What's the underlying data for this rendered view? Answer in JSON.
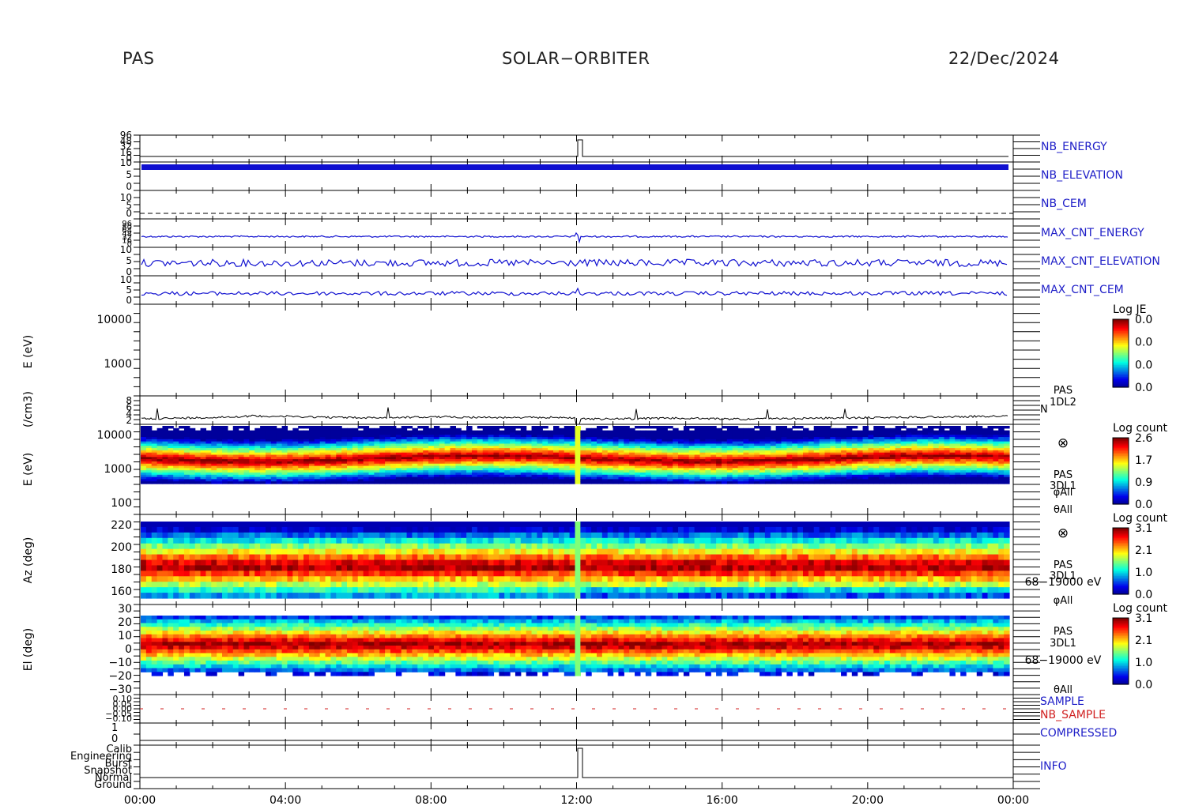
{
  "header": {
    "instrument": "PAS",
    "mission": "SOLAR−ORBITER",
    "date": "22/Dec/2024"
  },
  "time_axis": {
    "ticks": [
      "00:00",
      "04:00",
      "08:00",
      "12:00",
      "16:00",
      "20:00",
      "00:00"
    ]
  },
  "colors": {
    "trace_blue": "#1010d0",
    "label_blue": "#2020c8",
    "label_red": "#d02020",
    "axis": "#000000"
  },
  "panels": {
    "nb_energy": {
      "label": "NB_ENERGY",
      "yticks": [
        "96",
        "48",
        "32",
        "16",
        "0"
      ]
    },
    "nb_elevation": {
      "label": "NB_ELEVATION",
      "yticks": [
        "10",
        "5",
        "0"
      ]
    },
    "nb_cem": {
      "label": "NB_CEM",
      "yticks": [
        "10",
        "5",
        "0"
      ]
    },
    "max_cnt_energy": {
      "label": "MAX_CNT_ENERGY",
      "yticks": [
        "96",
        "80",
        "64",
        "48",
        "32",
        "16",
        "0"
      ]
    },
    "max_cnt_elevation": {
      "label": "MAX_CNT_ELEVATION",
      "yticks": [
        "10",
        "5",
        "0"
      ]
    },
    "max_cnt_cem": {
      "label": "MAX_CNT_CEM",
      "yticks": [
        "10",
        "5",
        "0"
      ]
    },
    "e_l2": {
      "ylabel": "E (eV)",
      "yticks": [
        "10000",
        "1000"
      ],
      "cbar_title": "Log JE",
      "cbar_ticks": [
        "0.0",
        "0.0",
        "0.0",
        "0.0"
      ]
    },
    "density": {
      "ylabel": "(/cm3)",
      "yticks": [
        "8",
        "6",
        "4",
        "2"
      ],
      "side_label_1": "PAS",
      "side_label_2": "1DL2",
      "side_label_3": "N"
    },
    "e_l1": {
      "ylabel": "E (eV)",
      "yticks": [
        "10000",
        "1000",
        "100"
      ],
      "cbar_title": "Log count",
      "cbar_ticks": [
        "2.6",
        "1.7",
        "0.9",
        "0.0"
      ],
      "sym": "⊗",
      "side_label_1": "PAS",
      "side_label_2": "3DL1",
      "side_label_3": "φAll",
      "side_label_4": "θAll"
    },
    "az": {
      "ylabel": "Az (deg)",
      "yticks": [
        "220",
        "200",
        "180",
        "160"
      ],
      "cbar_title": "Log count",
      "cbar_ticks": [
        "3.1",
        "2.1",
        "1.0",
        "0.0"
      ],
      "sym": "⊗",
      "side_label_1": "PAS",
      "side_label_2": "3DL1",
      "side_label_3": "68−19000 eV",
      "side_label_4": "φAll"
    },
    "el": {
      "ylabel": "El (deg)",
      "yticks": [
        "30",
        "20",
        "10",
        "0",
        "−10",
        "−20",
        "−30"
      ],
      "cbar_title": "Log count",
      "cbar_ticks": [
        "3.1",
        "2.1",
        "1.0",
        "0.0"
      ],
      "side_label_1": "PAS",
      "side_label_2": "3DL1",
      "side_label_3": "68−19000 eV",
      "side_label_4": "θAll"
    },
    "sample": {
      "label_1": "SAMPLE",
      "label_2": "NB_SAMPLE",
      "yticks": [
        "0.10",
        "0.05",
        "0.00",
        "−0.05",
        "−0.10"
      ]
    },
    "compressed": {
      "label": "COMPRESSED",
      "yticks": [
        "1",
        "0"
      ]
    },
    "info": {
      "label": "INFO",
      "yticks": [
        "Calib",
        "Engineering",
        "Burst",
        "Snapshot",
        "Normal",
        "Ground"
      ]
    }
  },
  "chart_data": {
    "type": "heatmap",
    "x_range": [
      "00:00",
      "24:00"
    ],
    "series": [
      {
        "name": "N",
        "values_cm3": [
          3.3,
          3.4,
          3.6,
          3.9,
          3.8,
          3.6,
          3.5,
          3.6,
          3.7,
          3.6,
          3.5,
          3.6,
          3.2,
          3.3,
          3.4,
          3.3,
          3.2,
          3.3,
          3.4,
          3.5,
          3.6,
          3.7,
          3.8,
          3.9
        ]
      },
      {
        "name": "MAX_CNT_ENERGY",
        "level_fraction": 0.62
      },
      {
        "name": "NB_ENERGY",
        "level_fraction": 0.1
      }
    ],
    "e_l1_peak_energy_eV": 1600,
    "az_peak_deg": 180,
    "el_peak_deg": 5
  }
}
